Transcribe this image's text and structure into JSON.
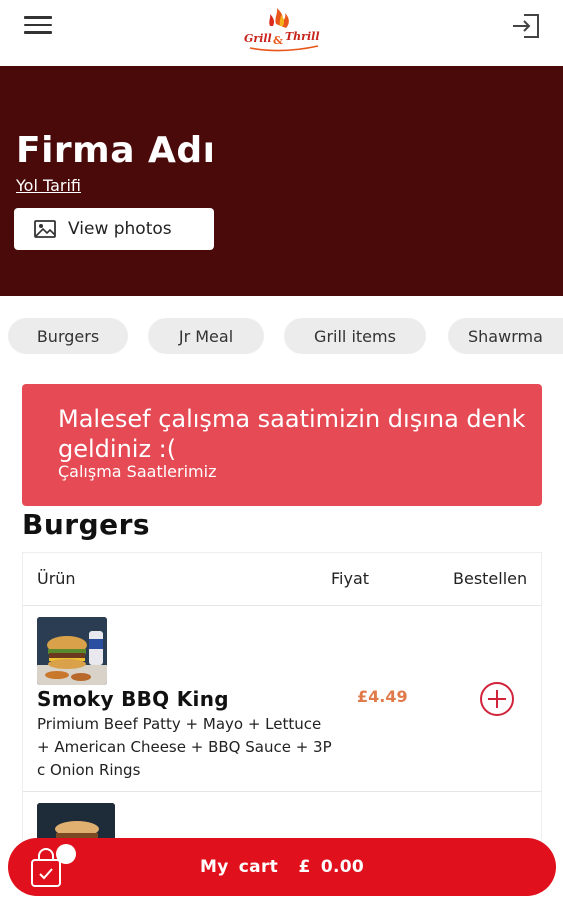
{
  "header": {
    "logo_text": "Grill & Thrill",
    "menu_icon": "hamburger-icon",
    "login_icon": "sign-in-icon"
  },
  "hero": {
    "title": "Firma Adı",
    "directions_link": "Yol Tarifi",
    "photos_button": "View photos",
    "background_color": "#4a0a0a"
  },
  "categories": [
    {
      "label": "Burgers"
    },
    {
      "label": "Jr Meal"
    },
    {
      "label": "Grill items"
    },
    {
      "label": "Shawrma"
    }
  ],
  "alert": {
    "message": "Malesef çalışma saatimizin dışına denk geldiniz :(",
    "link": "Çalışma Saatlerimiz",
    "color": "#e64a55"
  },
  "section": {
    "title": "Burgers"
  },
  "table": {
    "headers": [
      "Ürün",
      "Fiyat",
      "Bestellen"
    ],
    "rows": [
      {
        "name": "Smoky BBQ King",
        "description": "Primium Beef Patty + Mayo + Lettuce + American Cheese + BBQ Sauce + 3Pc Onion Rings",
        "price": "£4.49"
      }
    ]
  },
  "cart": {
    "label": "My cart",
    "amount": "£ 0.00",
    "color": "#e0101c"
  }
}
